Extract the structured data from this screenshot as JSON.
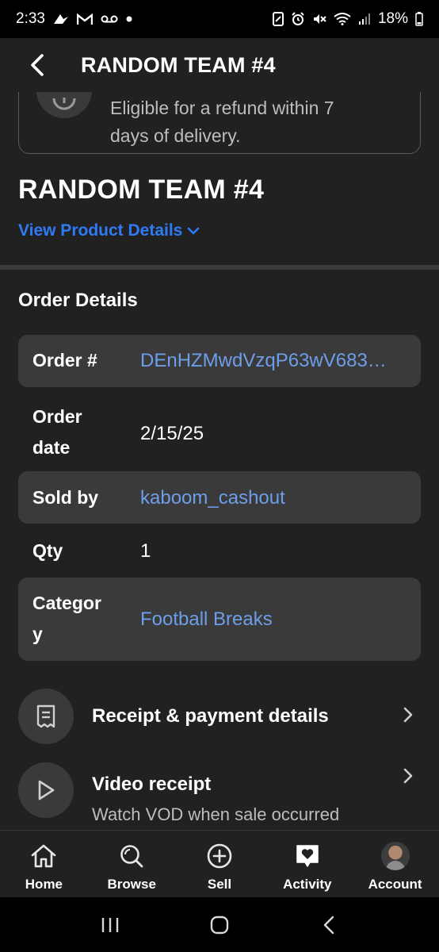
{
  "status_bar": {
    "time": "2:33",
    "battery": "18%",
    "left_icons": [
      "kite-icon",
      "gmail-icon",
      "voicemail-icon",
      "dot-icon"
    ],
    "right_icons": [
      "nfc-icon",
      "alarm-icon",
      "mute-icon",
      "wifi-icon",
      "signal-icon",
      "battery-icon"
    ]
  },
  "app_bar": {
    "title": "RANDOM TEAM #4",
    "back_icon": "back-arrow-icon"
  },
  "refund": {
    "text": "Eligible for a refund within 7 days of delivery."
  },
  "product": {
    "title": "RANDOM TEAM #4",
    "view_details": "View Product Details"
  },
  "order_details": {
    "title": "Order Details",
    "rows": [
      {
        "label": "Order #",
        "value": "DEnHZMwdVzqP63wV683…"
      },
      {
        "label": "Order date",
        "value": "2/15/25"
      },
      {
        "label": "Sold by",
        "value": "kaboom_cashout"
      },
      {
        "label": "Qty",
        "value": "1"
      },
      {
        "label": "Categor y",
        "value": "Football Breaks"
      }
    ]
  },
  "actions": {
    "receipt": {
      "title": "Receipt & payment details",
      "icon": "receipt-icon"
    },
    "video": {
      "title": "Video receipt",
      "subtitle": "Watch VOD when sale occurred",
      "icon": "play-icon"
    }
  },
  "bottom_nav": {
    "items": [
      {
        "label": "Home",
        "icon": "home-icon"
      },
      {
        "label": "Browse",
        "icon": "search-icon"
      },
      {
        "label": "Sell",
        "icon": "plus-circle-icon"
      },
      {
        "label": "Activity",
        "icon": "heart-chat-icon",
        "active": true
      },
      {
        "label": "Account",
        "icon": "avatar"
      }
    ]
  },
  "colors": {
    "background": "#212121",
    "row_shade": "#3a3a3a",
    "link": "#6d9eea",
    "accent_blue": "#2f7bf6"
  }
}
